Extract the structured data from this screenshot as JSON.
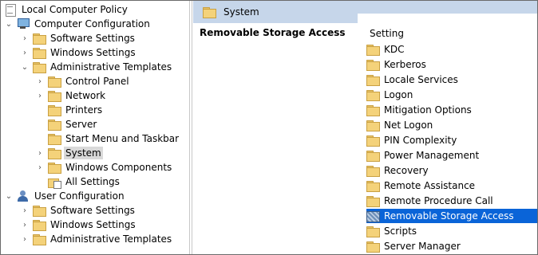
{
  "tree": {
    "root": "Local Computer Policy",
    "computer_configuration": "Computer Configuration",
    "user_configuration": "User Configuration",
    "items": [
      {
        "label": "Software Settings"
      },
      {
        "label": "Windows Settings"
      },
      {
        "label": "Administrative Templates"
      },
      {
        "label": "Control Panel"
      },
      {
        "label": "Network"
      },
      {
        "label": "Printers"
      },
      {
        "label": "Server"
      },
      {
        "label": "Start Menu and Taskbar"
      },
      {
        "label": "System"
      },
      {
        "label": "Windows Components"
      },
      {
        "label": "All Settings"
      }
    ],
    "user_items": [
      {
        "label": "Software Settings"
      },
      {
        "label": "Windows Settings"
      },
      {
        "label": "Administrative Templates"
      }
    ]
  },
  "details": {
    "path_title": "System",
    "heading": "Removable Storage Access",
    "column_header": "Setting",
    "items": [
      {
        "label": "KDC"
      },
      {
        "label": "Kerberos"
      },
      {
        "label": "Locale Services"
      },
      {
        "label": "Logon"
      },
      {
        "label": "Mitigation Options"
      },
      {
        "label": "Net Logon"
      },
      {
        "label": "PIN Complexity"
      },
      {
        "label": "Power Management"
      },
      {
        "label": "Recovery"
      },
      {
        "label": "Remote Assistance"
      },
      {
        "label": "Remote Procedure Call"
      },
      {
        "label": "Removable Storage Access"
      },
      {
        "label": "Scripts"
      },
      {
        "label": "Server Manager"
      }
    ]
  },
  "colors": {
    "selection_blue": "#0a64d8",
    "header_bg": "#c6d6ea",
    "tree_selection": "#d9d9d9"
  }
}
